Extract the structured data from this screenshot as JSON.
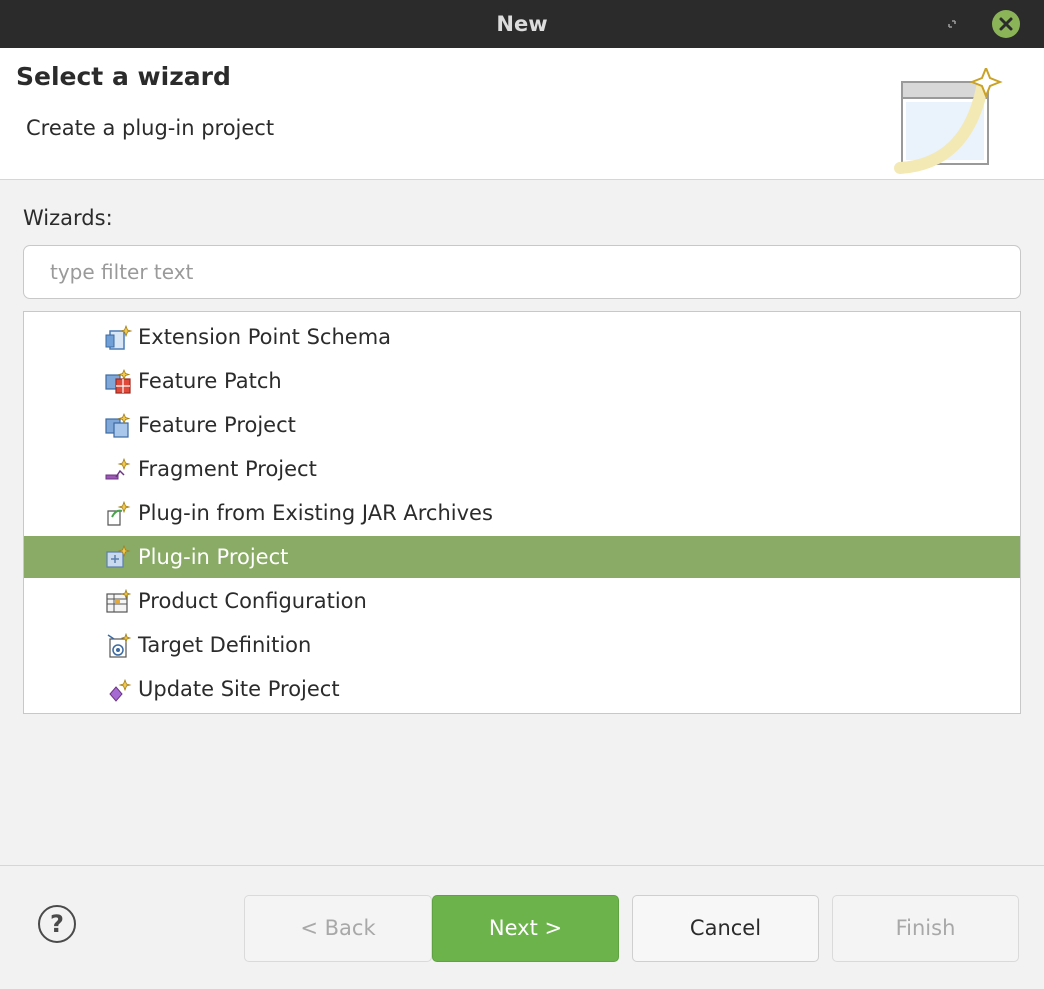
{
  "window": {
    "title": "New"
  },
  "banner": {
    "heading": "Select a wizard",
    "description": "Create a plug-in project"
  },
  "wizards": {
    "label": "Wizards:",
    "filter_placeholder": "type filter text",
    "filter_value": "",
    "items": [
      {
        "label": "Extension Point Schema",
        "icon": "schema-icon",
        "selected": false
      },
      {
        "label": "Feature Patch",
        "icon": "feature-patch-icon",
        "selected": false
      },
      {
        "label": "Feature Project",
        "icon": "feature-project-icon",
        "selected": false
      },
      {
        "label": "Fragment Project",
        "icon": "fragment-project-icon",
        "selected": false
      },
      {
        "label": "Plug-in from Existing JAR Archives",
        "icon": "plugin-jar-icon",
        "selected": false
      },
      {
        "label": "Plug-in Project",
        "icon": "plugin-project-icon",
        "selected": true
      },
      {
        "label": "Product Configuration",
        "icon": "product-configuration-icon",
        "selected": false
      },
      {
        "label": "Target Definition",
        "icon": "target-definition-icon",
        "selected": false
      },
      {
        "label": "Update Site Project",
        "icon": "update-site-icon",
        "selected": false
      }
    ]
  },
  "buttons": {
    "help": "?",
    "back": "< Back",
    "next": "Next >",
    "cancel": "Cancel",
    "finish": "Finish"
  },
  "colors": {
    "titlebar": "#2b2b2b",
    "selection": "#8aab66",
    "primary_button": "#6bb34a",
    "close_button": "#8ab457"
  }
}
